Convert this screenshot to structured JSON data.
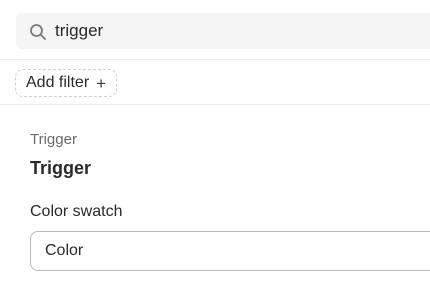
{
  "search": {
    "value": "trigger",
    "icon": "search-icon"
  },
  "filters": {
    "add_filter_label": "Add filter",
    "add_icon": "plus-icon",
    "add_icon_glyph": "+"
  },
  "section": {
    "label": "Trigger",
    "title": "Trigger"
  },
  "color_swatch": {
    "label": "Color swatch",
    "value": "Color"
  }
}
